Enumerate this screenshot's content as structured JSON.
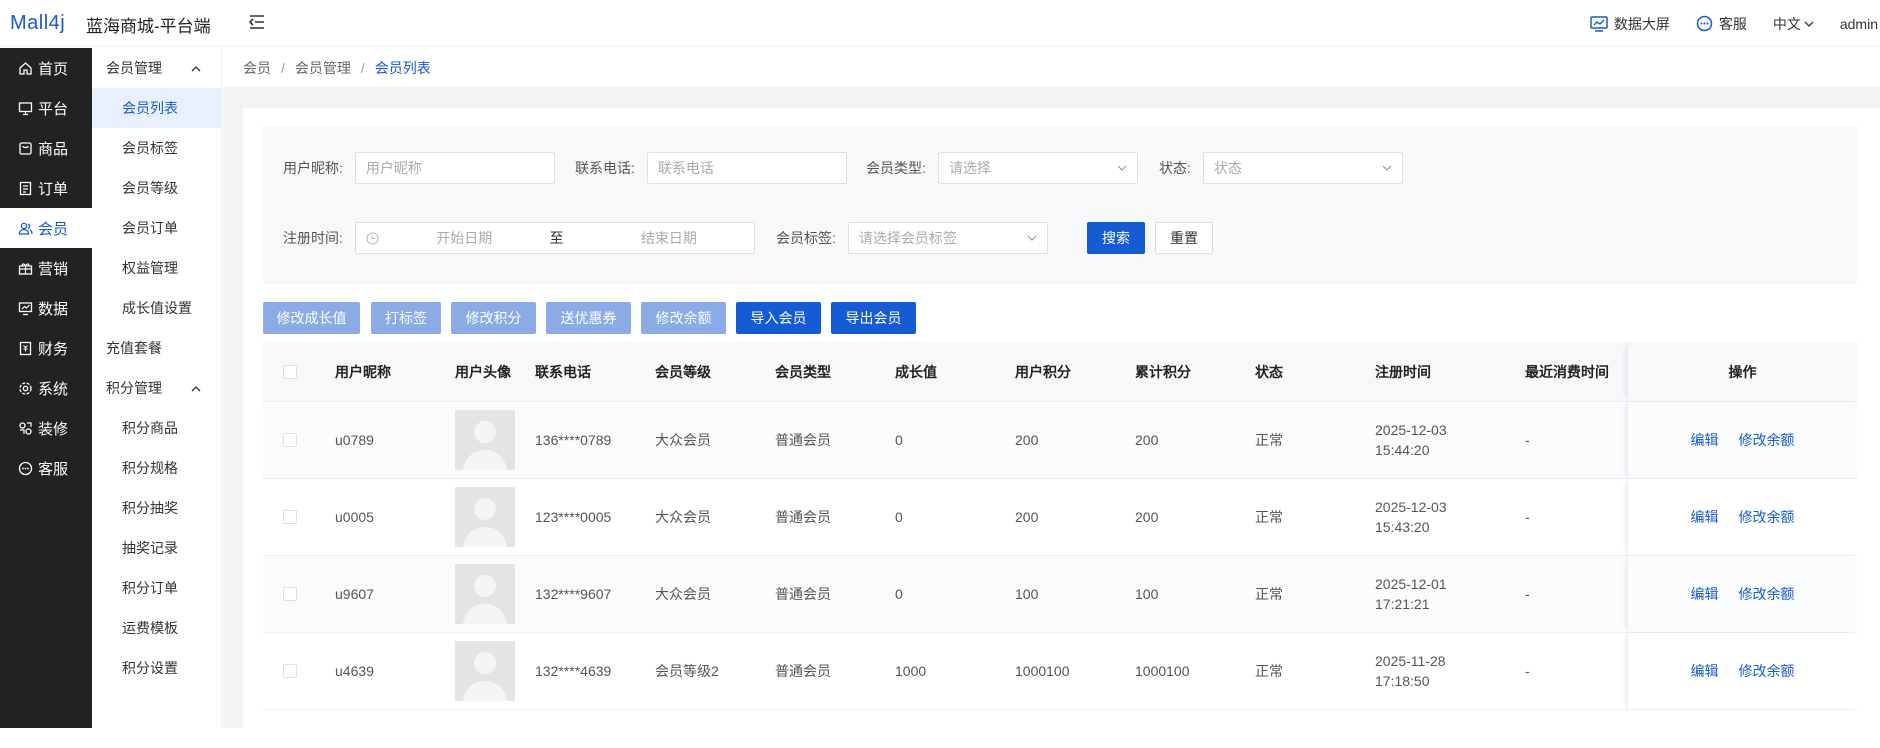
{
  "app": {
    "logo": "Mall4j",
    "title": "蓝海商城-平台端"
  },
  "topbar": {
    "screen_label": "数据大屏",
    "service_label": "客服",
    "lang_label": "中文",
    "user": "admin"
  },
  "sidebar_main": [
    {
      "label": "首页",
      "icon": "home-icon"
    },
    {
      "label": "平台",
      "icon": "monitor-icon"
    },
    {
      "label": "商品",
      "icon": "bag-icon"
    },
    {
      "label": "订单",
      "icon": "document-icon"
    },
    {
      "label": "会员",
      "icon": "users-icon",
      "active": true
    },
    {
      "label": "营销",
      "icon": "gift-icon"
    },
    {
      "label": "数据",
      "icon": "chart-icon"
    },
    {
      "label": "财务",
      "icon": "ledger-icon"
    },
    {
      "label": "系统",
      "icon": "gear-icon"
    },
    {
      "label": "装修",
      "icon": "decorate-icon"
    },
    {
      "label": "客服",
      "icon": "chat-icon"
    }
  ],
  "sidebar_sub": {
    "group1": "会员管理",
    "items1": [
      "会员列表",
      "会员标签",
      "会员等级",
      "会员订单",
      "权益管理",
      "成长值设置"
    ],
    "single": "充值套餐",
    "group2": "积分管理",
    "items2": [
      "积分商品",
      "积分规格",
      "积分抽奖",
      "抽奖记录",
      "积分订单",
      "运费模板",
      "积分设置"
    ]
  },
  "breadcrumb": [
    "会员",
    "会员管理",
    "会员列表"
  ],
  "search": {
    "nickname_label": "用户昵称:",
    "nickname_ph": "用户昵称",
    "phone_label": "联系电话:",
    "phone_ph": "联系电话",
    "type_label": "会员类型:",
    "type_ph": "请选择",
    "status_label": "状态:",
    "status_ph": "状态",
    "reg_label": "注册时间:",
    "start_ph": "开始日期",
    "to": "至",
    "end_ph": "结束日期",
    "tag_label": "会员标签:",
    "tag_ph": "请选择会员标签",
    "search_btn": "搜索",
    "reset_btn": "重置"
  },
  "actions": [
    "修改成长值",
    "打标签",
    "修改积分",
    "送优惠券",
    "修改余额",
    "导入会员",
    "导出会员"
  ],
  "table": {
    "headers": [
      "用户昵称",
      "用户头像",
      "联系电话",
      "会员等级",
      "会员类型",
      "成长值",
      "用户积分",
      "累计积分",
      "状态",
      "注册时间",
      "最近消费时间",
      "操作"
    ],
    "rows": [
      {
        "nick": "u0789",
        "phone": "136****0789",
        "level": "大众会员",
        "type": "普通会员",
        "growth": "0",
        "points": "200",
        "total": "200",
        "status": "正常",
        "date": "2025-12-03",
        "time": "15:44:20",
        "last": "-"
      },
      {
        "nick": "u0005",
        "phone": "123****0005",
        "level": "大众会员",
        "type": "普通会员",
        "growth": "0",
        "points": "200",
        "total": "200",
        "status": "正常",
        "date": "2025-12-03",
        "time": "15:43:20",
        "last": "-"
      },
      {
        "nick": "u9607",
        "phone": "132****9607",
        "level": "大众会员",
        "type": "普通会员",
        "growth": "0",
        "points": "100",
        "total": "100",
        "status": "正常",
        "date": "2025-12-01",
        "time": "17:21:21",
        "last": "-"
      },
      {
        "nick": "u4639",
        "phone": "132****4639",
        "level": "会员等级2",
        "type": "普通会员",
        "growth": "1000",
        "points": "1000100",
        "total": "1000100",
        "status": "正常",
        "date": "2025-11-28",
        "time": "17:18:50",
        "last": "-"
      }
    ],
    "op_edit": "编辑",
    "op_balance": "修改余额"
  }
}
